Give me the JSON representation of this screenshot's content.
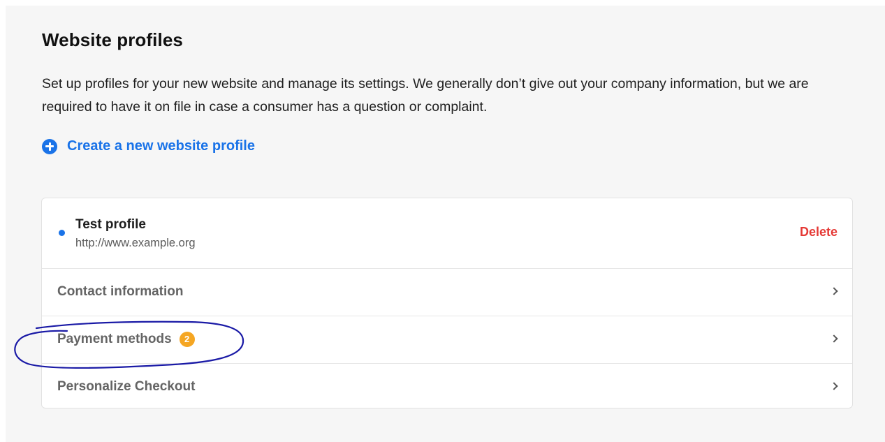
{
  "header": {
    "title": "Website profiles",
    "description": "Set up profiles for your new website and manage its settings. We generally don’t give out your company information, but we are required to have it on file in case a consumer has a question or complaint."
  },
  "create_link": {
    "icon": "plus-circle-icon",
    "label": "Create a new website profile"
  },
  "profile": {
    "name": "Test profile",
    "url": "http://www.example.org",
    "status_color": "#1a73e8",
    "delete_label": "Delete"
  },
  "sections": [
    {
      "label": "Contact information",
      "badge": null
    },
    {
      "label": "Payment methods",
      "badge": "2"
    },
    {
      "label": "Personalize Checkout",
      "badge": null
    }
  ],
  "colors": {
    "accent": "#1a73e8",
    "danger": "#e53935",
    "badge": "#f5a623",
    "annotation_ink": "#1a1aa6"
  }
}
